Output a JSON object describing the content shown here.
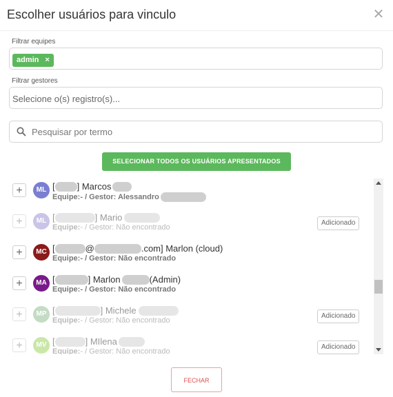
{
  "modal": {
    "title": "Escolher usuários para vinculo"
  },
  "filters": {
    "teams_label": "Filtrar equipes",
    "teams_chip": "admin",
    "chip_remove": "×",
    "managers_label": "Filtrar gestores",
    "managers_placeholder": "Selecione o(s) registro(s)..."
  },
  "search": {
    "placeholder": "Pesquisar por termo"
  },
  "select_all_label": "SELECIONAR TODOS OS USUÁRIOS APRESENTADOS",
  "users": [
    {
      "initials": "ML",
      "avatar_color": "#7b7fd1",
      "name_parts": [
        "[",
        "] Marcos",
        ""
      ],
      "sub_prefix": "Equipe:",
      "sub_text": " - / Gestor: Alessandro",
      "added": false
    },
    {
      "initials": "ML",
      "avatar_color": "#a8a0d8",
      "name_parts": [
        "[",
        "] Mario",
        ""
      ],
      "sub_prefix": "Equipe:",
      "sub_text": " - / Gestor: Não encontrado",
      "added": true
    },
    {
      "initials": "MC",
      "avatar_color": "#8b1a1a",
      "name_parts": [
        "[",
        "@",
        ".com] Marlon (cloud)"
      ],
      "sub_prefix": "Equipe:",
      "sub_text": " - / Gestor: Não encontrado",
      "added": false
    },
    {
      "initials": "MA",
      "avatar_color": "#7a1a8a",
      "name_parts": [
        "[",
        "] Marlon",
        "(Admin)"
      ],
      "sub_prefix": "Equipe:",
      "sub_text": " - / Gestor: Não encontrado",
      "added": false
    },
    {
      "initials": "MP",
      "avatar_color": "#9ec49e",
      "name_parts": [
        "[",
        "] Michele",
        ""
      ],
      "sub_prefix": "Equipe:",
      "sub_text": " - / Gestor: Não encontrado",
      "added": true
    },
    {
      "initials": "MV",
      "avatar_color": "#a8d86e",
      "name_parts": [
        "[",
        "] MIlena",
        ""
      ],
      "sub_prefix": "Equipe:",
      "sub_text": " - / Gestor: Não encontrado",
      "added": true
    }
  ],
  "added_label": "Adicionado",
  "add_symbol": "+",
  "close_label": "FECHAR",
  "colors": {
    "accent": "#5cb85c",
    "danger": "#d9534f"
  }
}
